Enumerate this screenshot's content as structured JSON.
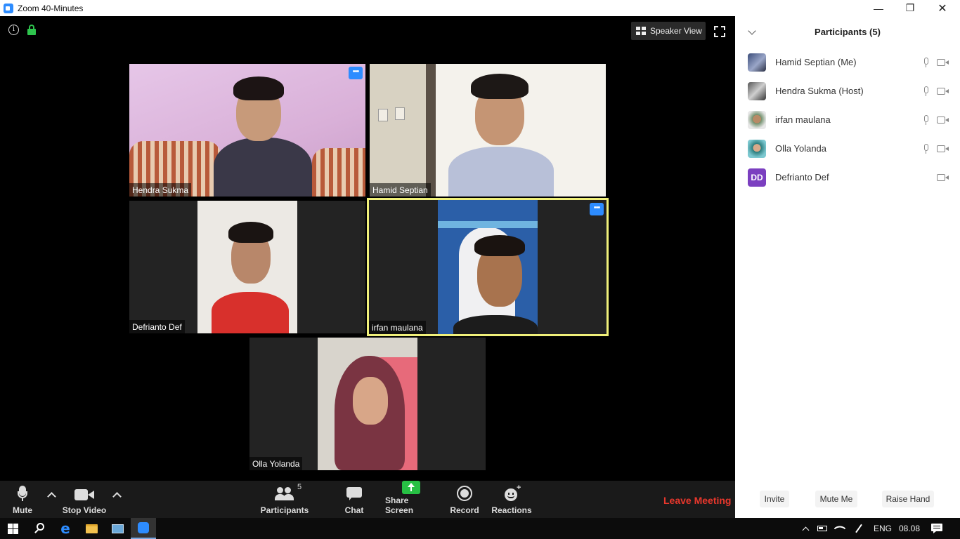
{
  "window": {
    "title": "Zoom 40-Minutes",
    "controls": [
      "minimize",
      "restore",
      "close"
    ]
  },
  "meeting": {
    "speaker_view_label": "Speaker View",
    "tiles": [
      {
        "name": "Hendra Sukma",
        "has_more": true,
        "highlight": false
      },
      {
        "name": "Hamid Septian",
        "has_more": false,
        "highlight": false
      },
      {
        "name": "Defrianto Def",
        "has_more": false,
        "highlight": false
      },
      {
        "name": "irfan maulana",
        "has_more": true,
        "highlight": true
      },
      {
        "name": "Olla Yolanda",
        "has_more": false,
        "highlight": false
      }
    ],
    "more_glyph": "•••",
    "info_glyph": "i"
  },
  "toolbar": {
    "mute": "Mute",
    "stop_video": "Stop Video",
    "participants": "Participants",
    "participants_count": "5",
    "chat": "Chat",
    "share_screen": "Share Screen",
    "record": "Record",
    "reactions": "Reactions",
    "leave": "Leave Meeting"
  },
  "panel": {
    "title": "Participants (5)",
    "participants": [
      {
        "name": "Hamid Septian (Me)",
        "mic": true,
        "cam": true
      },
      {
        "name": "Hendra Sukma (Host)",
        "mic": true,
        "cam": true
      },
      {
        "name": "irfan maulana",
        "mic": true,
        "cam": true
      },
      {
        "name": "Olla Yolanda",
        "mic": true,
        "cam": true
      },
      {
        "name": "Defrianto Def",
        "mic": false,
        "cam": true,
        "initials": "DD"
      }
    ],
    "buttons": {
      "invite": "Invite",
      "mute_me": "Mute Me",
      "raise_hand": "Raise Hand"
    }
  },
  "taskbar": {
    "language": "ENG",
    "time": "08.08"
  },
  "colors": {
    "accent": "#2d8cff",
    "leave": "#e8372c",
    "active_border": "#f0f07a",
    "dd_avatar": "#7b3fc0"
  }
}
